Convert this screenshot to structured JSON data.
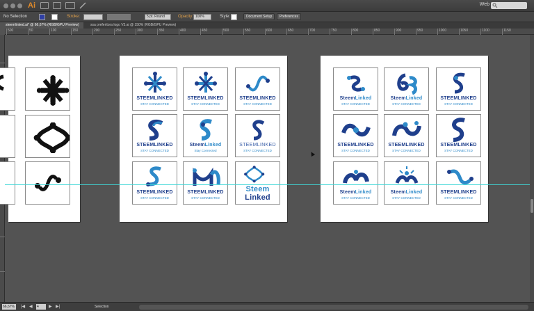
{
  "app": {
    "logo": "Ai",
    "workspace": "Web",
    "search_placeholder": ""
  },
  "controlbar": {
    "selection": "No Selection",
    "stroke_label": "Stroke:",
    "brush": "5 pt. Round",
    "opacity_label": "Opacity:",
    "opacity_value": "100%",
    "style_label": "Style:",
    "doc_setup": "Document Setup",
    "preferences": "Preferences"
  },
  "tabs": [
    {
      "label": "steemlinked.ai* @ 66,67% (RGB/GPU Preview)",
      "active": true
    },
    {
      "label": "ssa preferitora logo V3.ai @ 150% (RGB/GPU Preview)",
      "active": false
    }
  ],
  "ruler_top": [
    "500",
    "50",
    "100",
    "150",
    "200",
    "250",
    "300",
    "350",
    "400",
    "450",
    "500",
    "550",
    "600",
    "650",
    "700",
    "750",
    "800",
    "850",
    "900",
    "950",
    "1000",
    "1050",
    "1100",
    "1150"
  ],
  "status": {
    "zoom": "66,67%",
    "artboard": "4",
    "tool": "Selection"
  },
  "icons": [
    "close-icon",
    "minimize-icon",
    "zoom-icon",
    "bridge-icon",
    "stock-icon",
    "arrange-icon",
    "brush-icon",
    "search-icon"
  ],
  "colors": {
    "brand_dark": "#1f3f8c",
    "brand_light": "#2e8ac9",
    "guide": "#3fd6d6"
  },
  "artboard2": {
    "cells": [
      {
        "w1": "STEEMLINKED",
        "w2": "STAY CONNECTED"
      },
      {
        "w1": "STEEMLINKED",
        "w2": "STAY CONNECTED"
      },
      {
        "w1": "STEEMLINKED",
        "w2": "STAY CONNECTED"
      },
      {
        "w1": "STEEMLINKED",
        "w2": "STAY CONNECTED"
      },
      {
        "w1a": "Steem",
        "w1b": "Linked",
        "w2": "Stay Connected"
      },
      {
        "w1": "STEEMLINKED",
        "w2": "STAY CONNECTED"
      },
      {
        "w1": "STEEMLINKED",
        "w2": "STAY CONNECTED"
      },
      {
        "w1": "STEEMLINKED",
        "w2": "STAY CONNECTED"
      },
      {
        "w1a": "Steem",
        "w1b": "Linked"
      }
    ]
  },
  "artboard3": {
    "cells": [
      {
        "w1a": "Steem",
        "w1b": "Linked",
        "w2": "STAY CONNECTED"
      },
      {
        "w1a": "Steem",
        "w1b": "Linked",
        "w2": "STAY CONNECTED"
      },
      {
        "w1": "STEEMLINKED",
        "w2": "STAY CONNECTED"
      },
      {
        "w1": "STEEMLINKED",
        "w2": "STAY CONNECTED"
      },
      {
        "w1": "STEEMLINKED",
        "w2": "STAY CONNECTED"
      },
      {
        "w1": "STEEMLINKED",
        "w2": "STAY CONNECTED"
      },
      {
        "w1a": "Steem",
        "w1b": "Linked",
        "w2": "STAY CONNECTED"
      },
      {
        "w1a": "Steem",
        "w1b": "Linked",
        "w2": "STAY CONNECTED"
      },
      {
        "w1": "STEEMLINKED",
        "w2": "STAY CONNECTED"
      }
    ]
  }
}
